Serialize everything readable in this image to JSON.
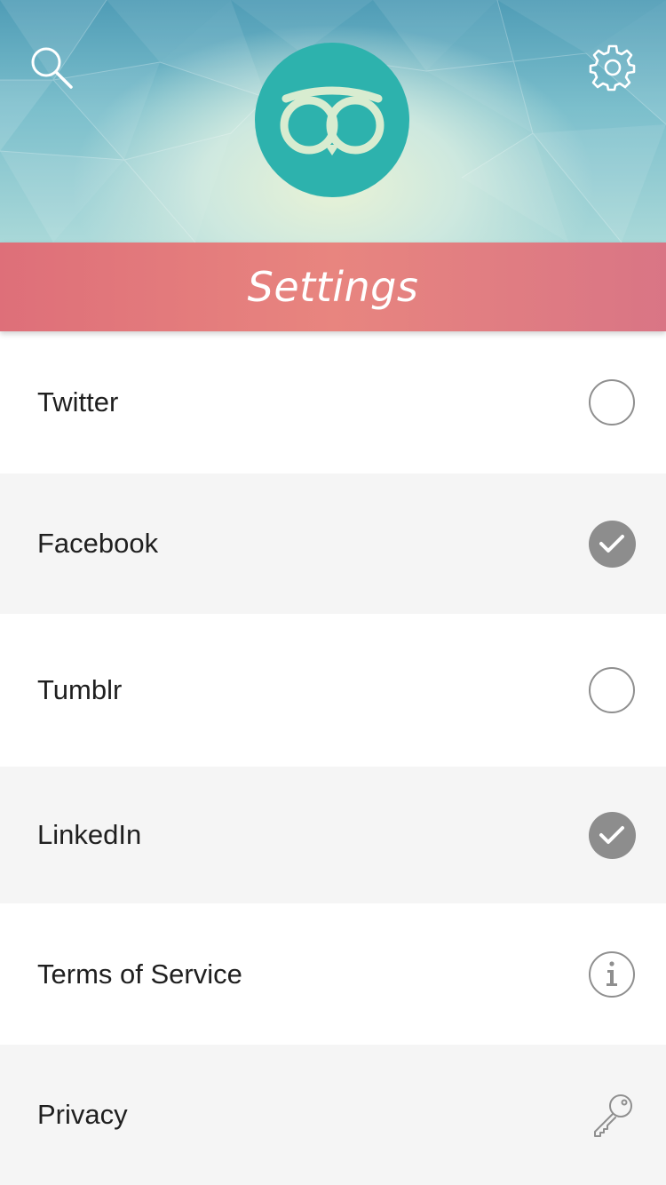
{
  "header": {
    "search_icon": "search-icon",
    "settings_icon": "gear-icon",
    "logo_icon": "owl-logo-icon",
    "logo_color": "#2db2ad"
  },
  "titlebar": {
    "title": "Settings",
    "background_color": "#e27d80"
  },
  "list": {
    "items": [
      {
        "label": "Twitter",
        "control": "radio",
        "selected": false,
        "icon": "radio-unchecked-icon"
      },
      {
        "label": "Facebook",
        "control": "radio",
        "selected": true,
        "icon": "check-circle-icon"
      },
      {
        "label": "Tumblr",
        "control": "radio",
        "selected": false,
        "icon": "radio-unchecked-icon"
      },
      {
        "label": "LinkedIn",
        "control": "radio",
        "selected": true,
        "icon": "check-circle-icon"
      },
      {
        "label": "Terms of Service",
        "control": "link",
        "icon": "info-icon"
      },
      {
        "label": "Privacy",
        "control": "link",
        "icon": "key-icon"
      }
    ]
  },
  "colors": {
    "row_alt_background": "#f5f5f5",
    "checked_fill": "#8d8d8d",
    "icon_stroke": "#8f8f8f"
  }
}
